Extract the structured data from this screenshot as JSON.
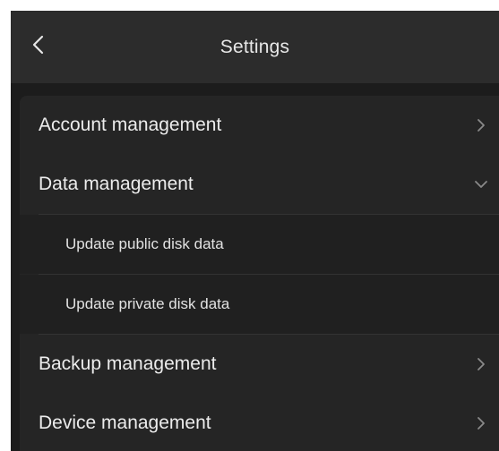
{
  "header": {
    "title": "Settings",
    "back_icon": "chevron-left-icon"
  },
  "menu": {
    "items": [
      {
        "label": "Account management",
        "icon": "chevron-right-icon",
        "expanded": false
      },
      {
        "label": "Data management",
        "icon": "chevron-down-icon",
        "expanded": true,
        "children": [
          {
            "label": "Update public disk data"
          },
          {
            "label": "Update private disk data"
          }
        ]
      },
      {
        "label": "Backup management",
        "icon": "chevron-right-icon",
        "expanded": false
      },
      {
        "label": "Device management",
        "icon": "chevron-right-icon",
        "expanded": false
      }
    ]
  },
  "colors": {
    "header_bg": "#2c2c2c",
    "page_bg": "#1c1c1c",
    "card_bg": "#252525",
    "text": "#ececec",
    "chevron": "#8a8a8a"
  }
}
